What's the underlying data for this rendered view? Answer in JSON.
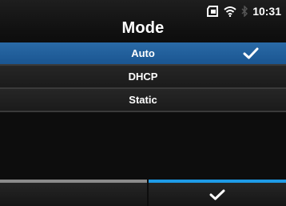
{
  "header": {
    "title": "Mode",
    "clock": "10:31",
    "status_icons": [
      "sd-card-icon",
      "wifi-icon",
      "bluetooth-icon"
    ]
  },
  "list": {
    "items": [
      {
        "label": "Auto",
        "selected": true,
        "checked": true
      },
      {
        "label": "DHCP",
        "selected": false,
        "checked": false
      },
      {
        "label": "Static",
        "selected": false,
        "checked": false
      }
    ]
  },
  "softkeys": {
    "left": {
      "label": ""
    },
    "right": {
      "icon": "checkmark-icon"
    }
  },
  "colors": {
    "selection": "#1f5e9e",
    "softkey_right_accent": "#1e9be6",
    "softkey_left_accent": "#8c8c8c"
  }
}
